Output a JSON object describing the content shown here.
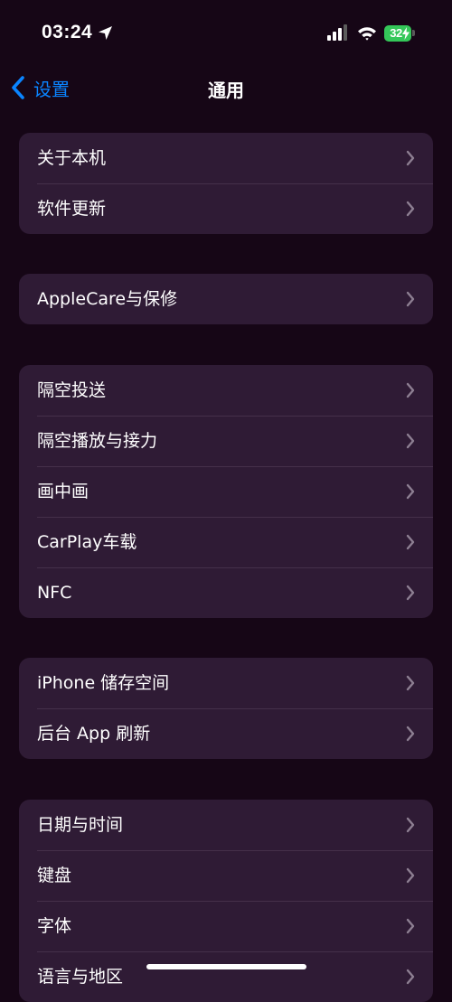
{
  "status_bar": {
    "time": "03:24",
    "battery_level": "32",
    "icons": [
      "location-arrow-icon",
      "cellular-signal-icon",
      "wifi-icon",
      "battery-icon",
      "charging-bolt-icon"
    ],
    "battery_color": "#34c759"
  },
  "nav": {
    "back_label": "设置",
    "title": "通用",
    "accent_color": "#0a84ff"
  },
  "groups": [
    {
      "items": [
        {
          "label": "关于本机"
        },
        {
          "label": "软件更新"
        }
      ]
    },
    {
      "items": [
        {
          "label": "AppleCare与保修"
        }
      ]
    },
    {
      "items": [
        {
          "label": "隔空投送"
        },
        {
          "label": "隔空播放与接力"
        },
        {
          "label": "画中画"
        },
        {
          "label": "CarPlay车载"
        },
        {
          "label": "NFC"
        }
      ]
    },
    {
      "items": [
        {
          "label": "iPhone 储存空间"
        },
        {
          "label": "后台 App 刷新"
        }
      ]
    },
    {
      "items": [
        {
          "label": "日期与时间"
        },
        {
          "label": "键盘"
        },
        {
          "label": "字体"
        },
        {
          "label": "语言与地区"
        }
      ]
    }
  ],
  "colors": {
    "background": "#160616",
    "group_background": "#2f1b35",
    "separator": "#45304a",
    "chevron": "#8d7f92"
  }
}
